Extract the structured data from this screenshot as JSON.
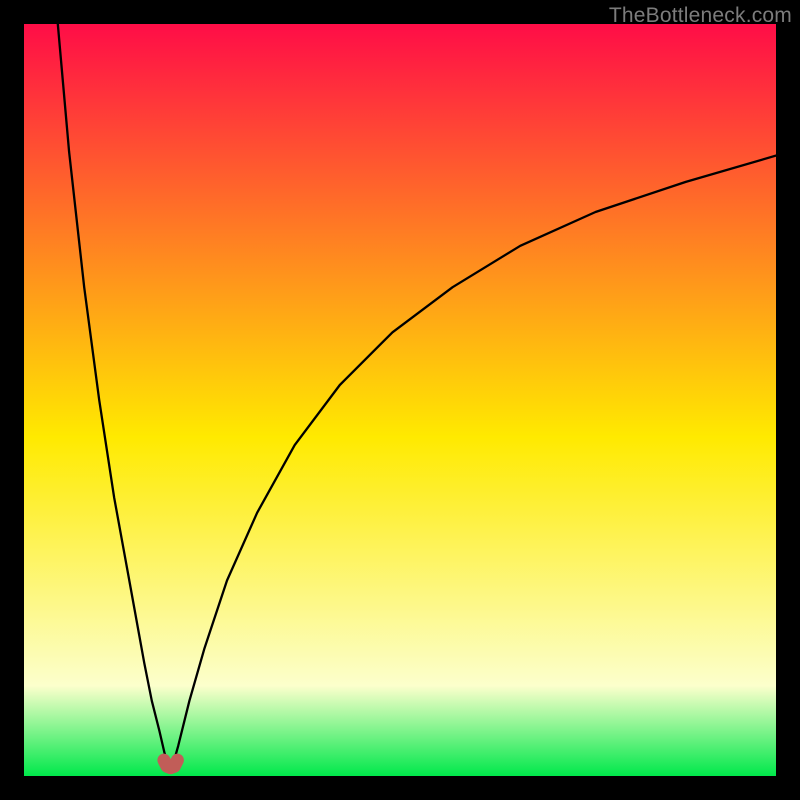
{
  "watermark": "TheBottleneck.com",
  "colors": {
    "top": "#ff0d47",
    "mid": "#ffea00",
    "pale": "#fcffcc",
    "bottom": "#00e84b",
    "curve": "#000000",
    "marker": "#c15d58",
    "frame": "#000000"
  },
  "chart_data": {
    "type": "line",
    "title": "",
    "xlabel": "",
    "ylabel": "",
    "xlim": [
      0,
      100
    ],
    "ylim": [
      0,
      100
    ],
    "grid": false,
    "legend": false,
    "annotations": [],
    "notch_x": 19.5,
    "series": [
      {
        "name": "curve-left",
        "x": [
          4.5,
          6,
          8,
          10,
          12,
          14,
          16,
          17,
          18,
          18.7,
          19.2
        ],
        "values": [
          100,
          83,
          65,
          50,
          37,
          26,
          15,
          10,
          6,
          3,
          1.5
        ]
      },
      {
        "name": "curve-right",
        "x": [
          19.8,
          20.5,
          22,
          24,
          27,
          31,
          36,
          42,
          49,
          57,
          66,
          76,
          88,
          100
        ],
        "values": [
          1.5,
          4,
          10,
          17,
          26,
          35,
          44,
          52,
          59,
          65,
          70.5,
          75,
          79,
          82.5
        ]
      },
      {
        "name": "bottom-marker",
        "type": "scatter",
        "x": [
          18.6,
          19.0,
          19.5,
          20.0,
          20.4
        ],
        "values": [
          2.1,
          1.3,
          1.1,
          1.3,
          2.1
        ],
        "color": "#c15d58"
      }
    ]
  }
}
